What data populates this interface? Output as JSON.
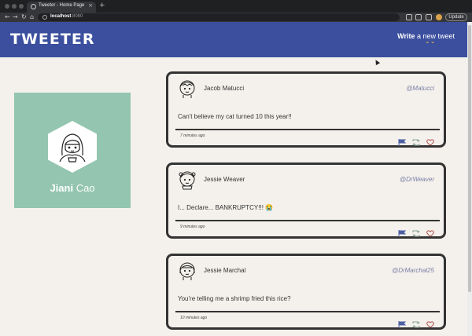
{
  "browser": {
    "tab_title": "Tweeter - Home Page",
    "tab_close": "×",
    "new_tab": "+",
    "url_host": "localhost",
    "url_port": ":8080",
    "update_label": "Update"
  },
  "header": {
    "logo": "TWEETER",
    "write_bold": "Write",
    "write_rest": " a new tweet",
    "chevron": "⌄⌄"
  },
  "profile": {
    "first_name": "Jiani",
    "last_name": " Cao",
    "background_color": "#93c5b0"
  },
  "tweets": [
    {
      "name": "Jacob Matucci",
      "handle": "@Matucci",
      "text": "Can't believe my cat turned 10 this year!!",
      "time": "7 minutes ago"
    },
    {
      "name": "Jessie Weaver",
      "handle": "@DrWeaver",
      "text": "I... Declare... BANKRUPTCY!!! 😭",
      "time": "9 minutes ago"
    },
    {
      "name": "Jessie Marchal",
      "handle": "@DrMarchal25",
      "text": "You're telling me a shrimp fried this rice?",
      "time": "10 minutes ago"
    }
  ],
  "colors": {
    "nav_bg": "#3b4f9e",
    "page_bg": "#f4f1ec",
    "accent": "#f2c14e",
    "handle": "#7a7fa6"
  },
  "icons": [
    "flag-icon",
    "retweet-icon",
    "heart-icon"
  ]
}
